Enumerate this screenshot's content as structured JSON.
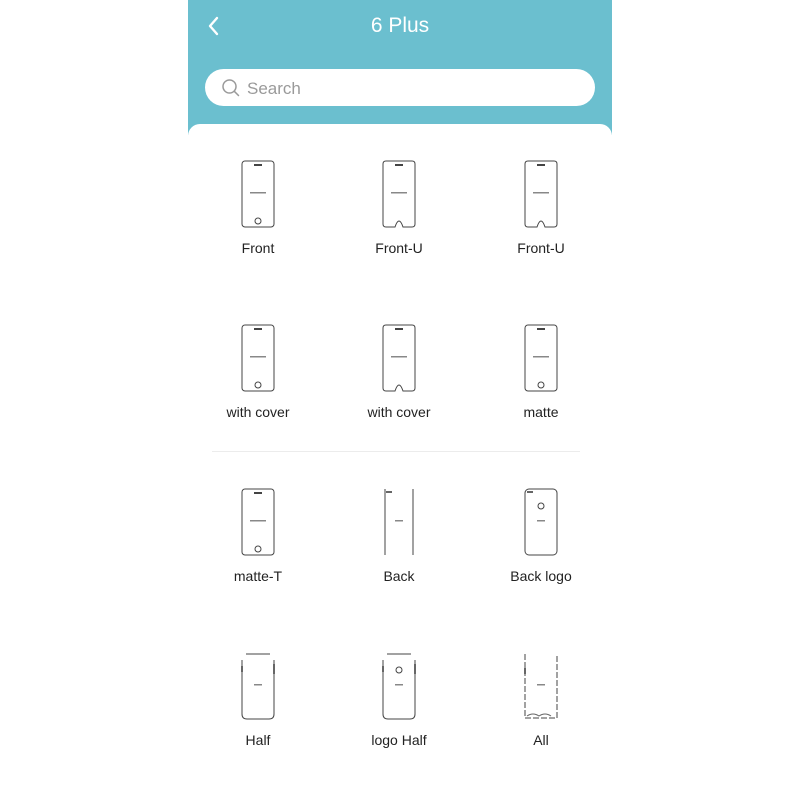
{
  "theme": {
    "accent": "#6bbfcf"
  },
  "header": {
    "back_icon": "chevron-left-icon",
    "title": "6 Plus"
  },
  "search": {
    "icon": "search-icon",
    "placeholder": "Search",
    "value": ""
  },
  "items": [
    {
      "label": "Front",
      "icon": "phone-front-icon"
    },
    {
      "label": "Front-U",
      "icon": "phone-front-u-icon"
    },
    {
      "label": "Front-U",
      "icon": "phone-front-u-icon"
    },
    {
      "label": "with cover",
      "icon": "phone-front-icon"
    },
    {
      "label": "with cover",
      "icon": "phone-front-u-icon"
    },
    {
      "label": "matte",
      "icon": "phone-front-icon"
    },
    {
      "label": "matte-T",
      "icon": "phone-front-icon"
    },
    {
      "label": "Back",
      "icon": "phone-back-icon"
    },
    {
      "label": "Back logo",
      "icon": "phone-back-logo-icon"
    },
    {
      "label": "Half",
      "icon": "phone-half-icon"
    },
    {
      "label": "logo Half",
      "icon": "phone-logo-half-icon"
    },
    {
      "label": "All",
      "icon": "phone-all-icon"
    }
  ]
}
